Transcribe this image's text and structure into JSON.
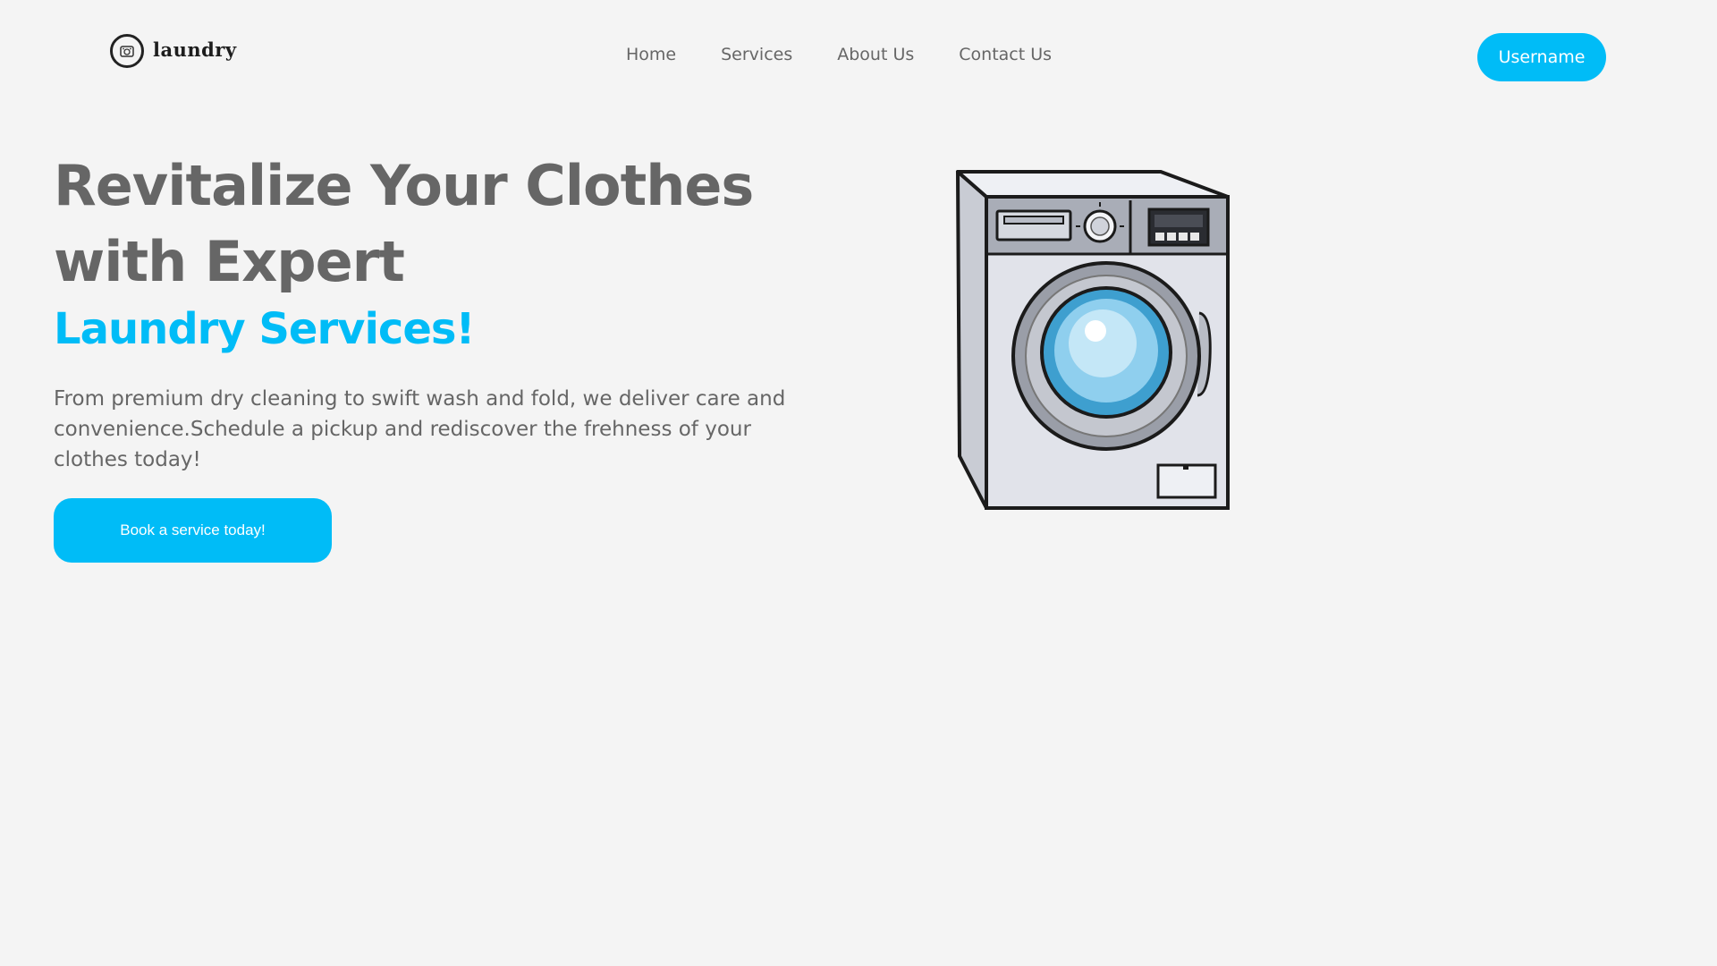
{
  "brand": {
    "name": "laundry",
    "logo_icon": "washer-logo-icon"
  },
  "nav": {
    "items": [
      {
        "label": "Home"
      },
      {
        "label": "Services"
      },
      {
        "label": "About Us"
      },
      {
        "label": "Contact Us"
      }
    ]
  },
  "account": {
    "username_label": "Username"
  },
  "hero": {
    "title": "Revitalize Your Clothes with Expert",
    "subtitle": "Laundry Services!",
    "description": "From premium dry cleaning to swift wash and fold, we deliver care and convenience.Schedule a pickup and rediscover the frehness of your clothes today!",
    "cta_label": "Book a service today!",
    "illustration_icon": "washing-machine-icon"
  },
  "colors": {
    "accent": "#00bcf7",
    "text_muted": "#666666",
    "background": "#f4f4f4"
  }
}
